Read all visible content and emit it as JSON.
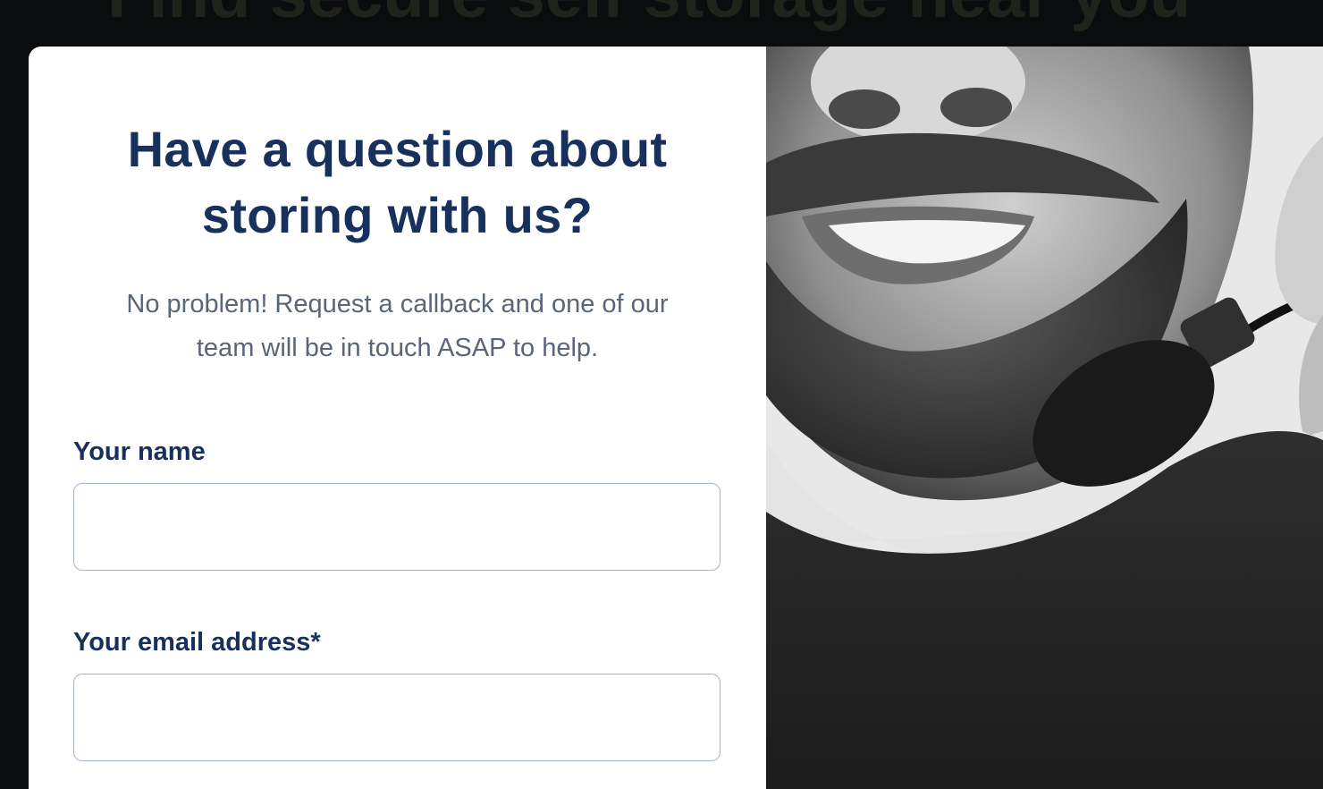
{
  "background": {
    "heading": "Find secure self storage near you"
  },
  "form": {
    "title": "Have a question about storing with us?",
    "subtitle": "No problem! Request a callback and one of our team will be in touch ASAP to help.",
    "fields": [
      {
        "label": "Your name",
        "value": "",
        "placeholder": ""
      },
      {
        "label": "Your email address*",
        "value": "",
        "placeholder": ""
      }
    ]
  },
  "colors": {
    "brand_navy": "#17305c",
    "body_text": "#5b6578",
    "input_border": "#a9b4c9",
    "backdrop": "#0b0c0e"
  }
}
